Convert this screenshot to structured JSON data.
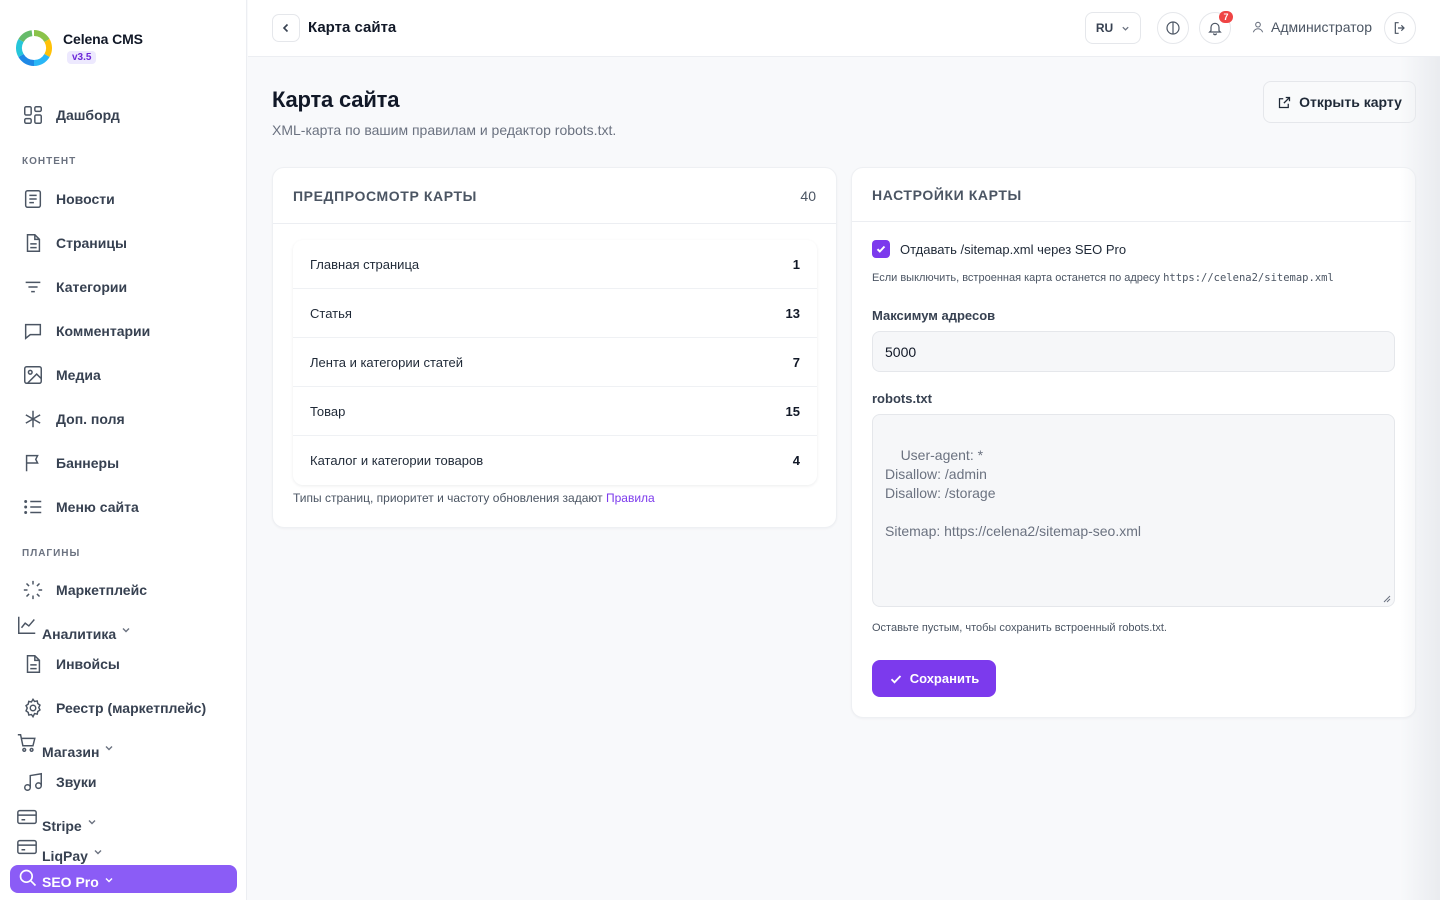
{
  "brand": {
    "name": "Celena CMS",
    "version": "v3.5"
  },
  "sidebar": {
    "dashboard": "Дашборд",
    "section_content": "КОНТЕНТ",
    "content_items": [
      "Новости",
      "Страницы",
      "Категории",
      "Комментарии",
      "Медиа",
      "Доп. поля",
      "Баннеры",
      "Меню сайта"
    ],
    "section_plugins": "ПЛАГИНЫ",
    "marketplace": "Маркетплейс",
    "analytics": "Аналитика",
    "invoices": "Инвойсы",
    "registry": "Реестр (маркетплейс)",
    "shop": "Магазин",
    "sounds": "Звуки",
    "stripe": "Stripe",
    "liqpay": "LiqPay",
    "seo_pro": "SEO Pro"
  },
  "topbar": {
    "title": "Карта сайта",
    "language": "RU",
    "notifications_count": "7",
    "user": "Администратор"
  },
  "page": {
    "title": "Карта сайта",
    "subtitle": "XML-карта по вашим правилам и редактор robots.txt.",
    "open_button": "Открыть карту"
  },
  "preview": {
    "title": "ПРЕДПРОСМОТР КАРТЫ",
    "total": "40",
    "rows": [
      {
        "label": "Главная страница",
        "value": "1"
      },
      {
        "label": "Статья",
        "value": "13"
      },
      {
        "label": "Лента и категории статей",
        "value": "7"
      },
      {
        "label": "Товар",
        "value": "15"
      },
      {
        "label": "Каталог и категории товаров",
        "value": "4"
      }
    ],
    "note": "Типы страниц, приоритет и частоту обновления задают",
    "note_link": "Правила"
  },
  "settings": {
    "title": "НАСТРОЙКИ КАРТЫ",
    "checkbox_label": "Отдавать /sitemap.xml через SEO Pro",
    "checkbox_checked": true,
    "checkbox_hint": "Если выключить, встроенная карта останется по адресу",
    "checkbox_hint_url": "https://celena2/sitemap.xml",
    "max_label": "Максимум адресов",
    "max_value": "5000",
    "robots_label": "robots.txt",
    "robots_value": "User-agent: *\nDisallow: /admin\nDisallow: /storage\n\nSitemap: https://celena2/sitemap-seo.xml",
    "robots_hint": "Оставьте пустым, чтобы сохранить встроенный robots.txt.",
    "save_button": "Сохранить"
  },
  "colors": {
    "accent": "#7c3aed",
    "active_nav": "#8b5cf6",
    "badge": "#ef4444"
  }
}
